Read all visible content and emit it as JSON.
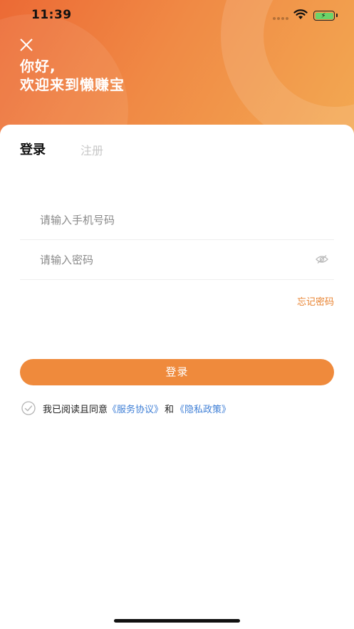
{
  "status_bar": {
    "time": "11:39",
    "icons": [
      "signal-dots-icon",
      "wifi-icon",
      "battery-charging-icon"
    ]
  },
  "header": {
    "close_icon": "close-icon",
    "greeting_line1": "你好,",
    "greeting_line2": "欢迎来到懒赚宝"
  },
  "tabs": {
    "login": "登录",
    "register": "注册"
  },
  "form": {
    "phone_placeholder": "请输入手机号码",
    "phone_value": "",
    "password_placeholder": "请输入密码",
    "password_value": "",
    "eye_icon": "eye-hidden-icon",
    "forgot_password": "忘记密码",
    "login_button": "登录"
  },
  "agreement": {
    "check_icon": "check-circle-icon",
    "prefix": "我已阅读且同意",
    "terms": "《服务协议》",
    "connector": "和",
    "privacy": "《隐私政策》"
  },
  "colors": {
    "accent": "#ef8a3c",
    "link": "#3f7fd6",
    "header_gradient_start": "#ec6a35",
    "header_gradient_end": "#f3a952"
  }
}
